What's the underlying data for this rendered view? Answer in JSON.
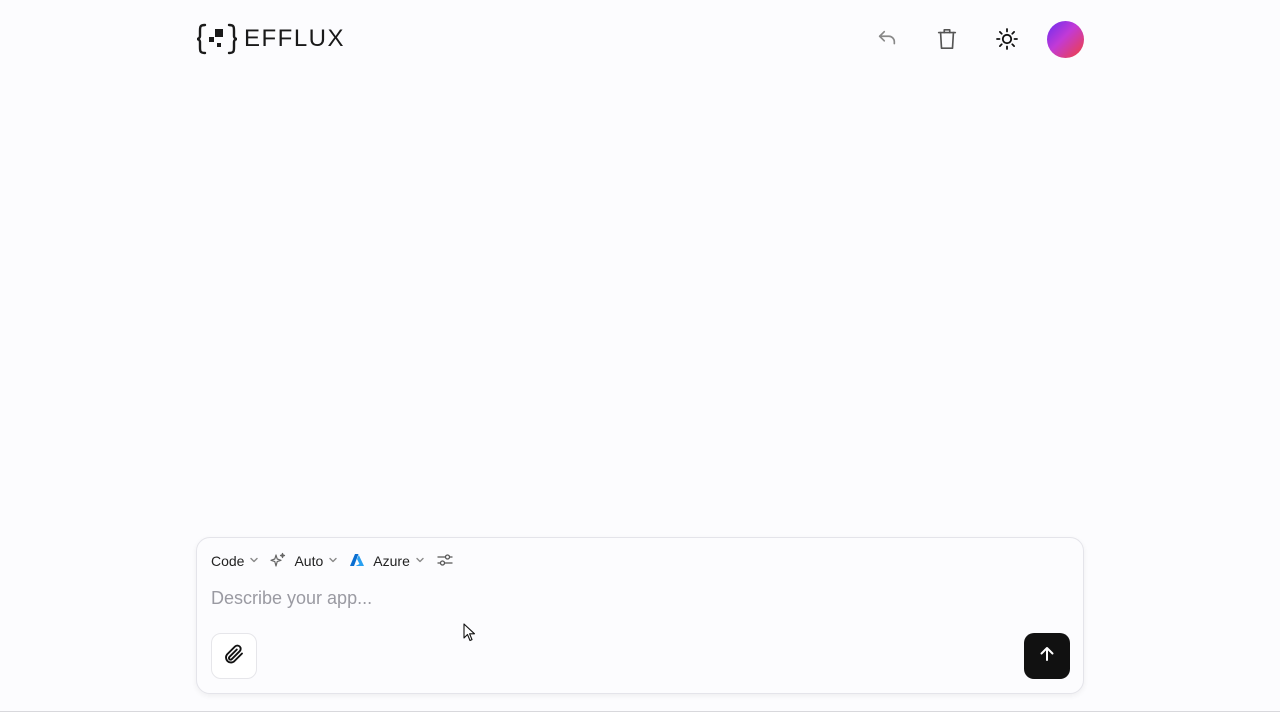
{
  "brand": {
    "name": "EFFLUX",
    "logo_icon": "bracket-pixels-logo"
  },
  "header": {
    "actions": [
      {
        "name": "undo",
        "icon": "undo-icon"
      },
      {
        "name": "delete",
        "icon": "trash-icon"
      },
      {
        "name": "theme",
        "icon": "sun-icon"
      },
      {
        "name": "profile",
        "icon": "avatar"
      }
    ]
  },
  "composer": {
    "mode": {
      "label": "Code",
      "icon": "chevron-down-icon"
    },
    "model": {
      "label": "Auto",
      "icon": "sparkles-icon"
    },
    "provider": {
      "label": "Azure",
      "icon": "azure-icon"
    },
    "settings_icon": "sliders-icon",
    "prompt_placeholder": "Describe your app...",
    "prompt_value": "",
    "attach_icon": "paperclip-icon",
    "send_icon": "arrow-up-icon"
  },
  "colors": {
    "background": "#fcfcfe",
    "send_button": "#111111",
    "avatar_gradient": [
      "#6a2cf0",
      "#c23ad6",
      "#f2403a"
    ],
    "azure_blue": "#0a6ed1"
  }
}
